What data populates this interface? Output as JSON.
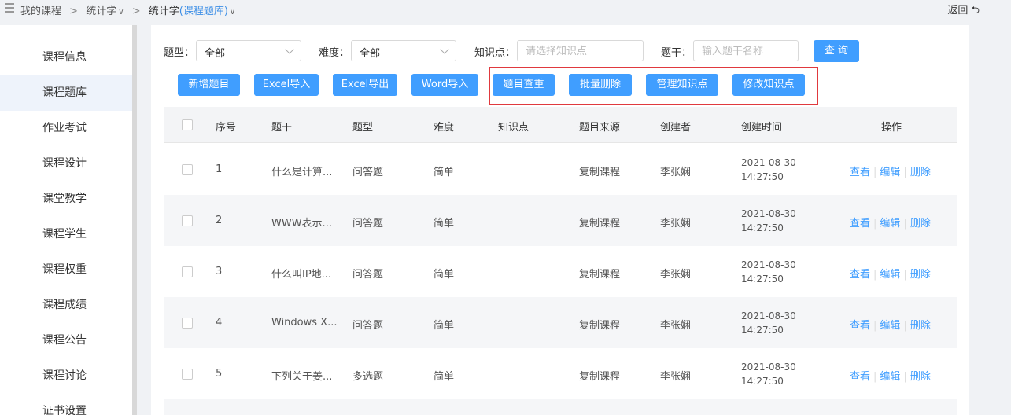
{
  "breadcrumb": {
    "item1": "我的课程",
    "item2": "统计学",
    "current_prefix": "统计学",
    "current_highlight": "(课程题库)",
    "sep": ">"
  },
  "header": {
    "back": "返回"
  },
  "sidebar": {
    "items": [
      {
        "label": "课程信息"
      },
      {
        "label": "课程题库"
      },
      {
        "label": "作业考试"
      },
      {
        "label": "课程设计"
      },
      {
        "label": "课堂教学"
      },
      {
        "label": "课程学生"
      },
      {
        "label": "课程权重"
      },
      {
        "label": "课程成绩"
      },
      {
        "label": "课程公告"
      },
      {
        "label": "课程讨论"
      },
      {
        "label": "证书设置"
      }
    ]
  },
  "filters": {
    "type_label": "题型：",
    "type_value": "全部",
    "difficulty_label": "难度：",
    "difficulty_value": "全部",
    "knowledge_label": "知识点：",
    "knowledge_placeholder": "请选择知识点",
    "stem_label": "题干：",
    "stem_placeholder": "输入题干名称",
    "query_button": "查 询"
  },
  "actions": {
    "add": "新增题目",
    "excel_import": "Excel导入",
    "excel_export": "Excel导出",
    "word_import": "Word导入",
    "dedupe": "题目查重",
    "batch_delete": "批量删除",
    "manage_knowledge": "管理知识点",
    "edit_knowledge": "修改知识点"
  },
  "table": {
    "headers": {
      "index": "序号",
      "stem": "题干",
      "type": "题型",
      "difficulty": "难度",
      "knowledge": "知识点",
      "source": "题目来源",
      "creator": "创建者",
      "created_at": "创建时间",
      "ops": "操作"
    },
    "op_labels": {
      "view": "查看",
      "edit": "编辑",
      "delete": "删除",
      "sep": "|"
    },
    "rows": [
      {
        "index": "1",
        "stem": "什么是计算...",
        "type": "问答题",
        "difficulty": "简单",
        "knowledge": "",
        "source": "复制课程",
        "creator": "李张娴",
        "date": "2021-08-30",
        "time": "14:27:50"
      },
      {
        "index": "2",
        "stem": "WWW表示...",
        "type": "问答题",
        "difficulty": "简单",
        "knowledge": "",
        "source": "复制课程",
        "creator": "李张娴",
        "date": "2021-08-30",
        "time": "14:27:50"
      },
      {
        "index": "3",
        "stem": "什么叫IP地...",
        "type": "问答题",
        "difficulty": "简单",
        "knowledge": "",
        "source": "复制课程",
        "creator": "李张娴",
        "date": "2021-08-30",
        "time": "14:27:50"
      },
      {
        "index": "4",
        "stem": "Windows X...",
        "type": "问答题",
        "difficulty": "简单",
        "knowledge": "",
        "source": "复制课程",
        "creator": "李张娴",
        "date": "2021-08-30",
        "time": "14:27:50"
      },
      {
        "index": "5",
        "stem": "下列关于姜...",
        "type": "多选题",
        "difficulty": "简单",
        "knowledge": "",
        "source": "复制课程",
        "creator": "李张娴",
        "date": "2021-08-30",
        "time": "14:27:50"
      }
    ]
  },
  "colors": {
    "primary": "#409eff",
    "highlight_border": "#e0393e",
    "link": "#409eff",
    "breadcrumb_accent": "#3d8fe6"
  }
}
